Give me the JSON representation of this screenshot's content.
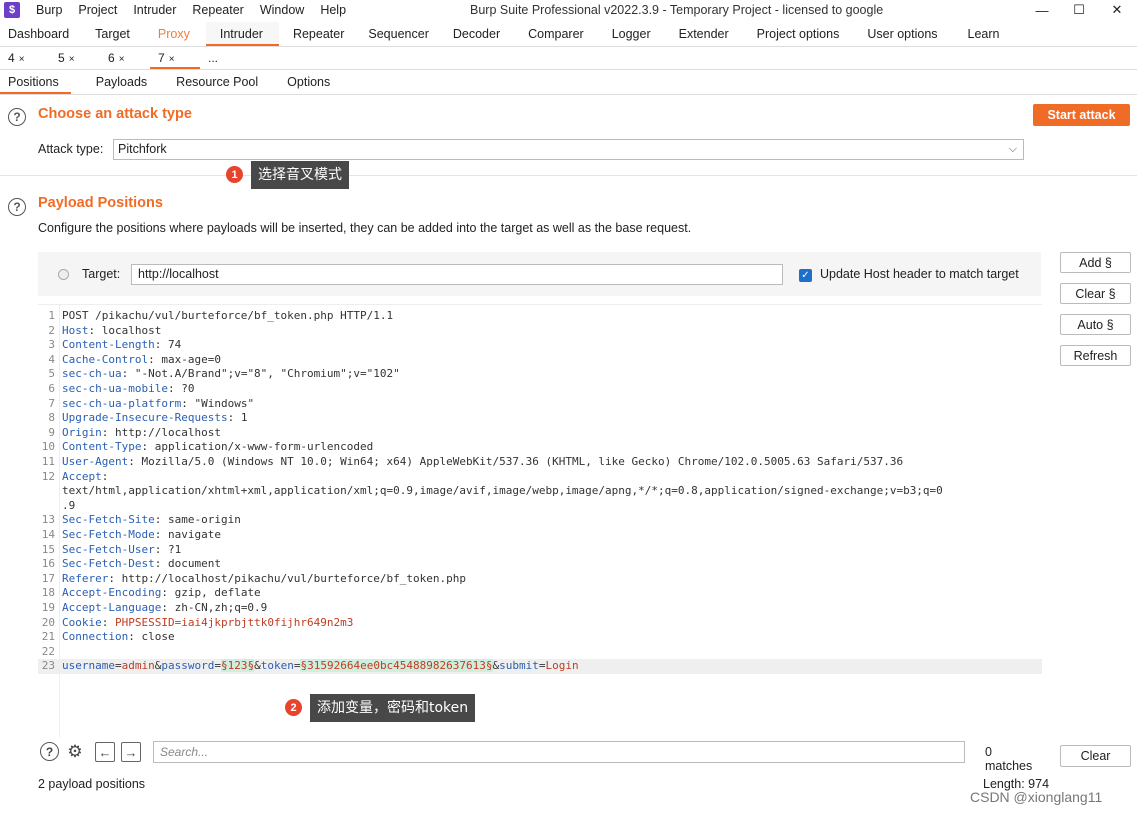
{
  "app": {
    "icon_label": "$",
    "title": "Burp Suite Professional v2022.3.9 - Temporary Project - licensed to google"
  },
  "menu": [
    "Burp",
    "Project",
    "Intruder",
    "Repeater",
    "Window",
    "Help"
  ],
  "window_controls": {
    "minimize": "—",
    "maximize": "☐",
    "close": "✕"
  },
  "main_tabs": [
    "Dashboard",
    "Target",
    "Proxy",
    "Intruder",
    "Repeater",
    "Sequencer",
    "Decoder",
    "Comparer",
    "Logger",
    "Extender",
    "Project options",
    "User options",
    "Learn"
  ],
  "sub_tabs": [
    {
      "label": "4",
      "close": "×"
    },
    {
      "label": "5",
      "close": "×"
    },
    {
      "label": "6",
      "close": "×"
    },
    {
      "label": "7",
      "close": "×"
    },
    {
      "label": "...",
      "close": ""
    }
  ],
  "section_tabs": [
    "Positions",
    "Payloads",
    "Resource Pool",
    "Options"
  ],
  "attack": {
    "title": "Choose an attack type",
    "start_label": "Start attack",
    "type_label": "Attack type:",
    "type_value": "Pitchfork",
    "chevron": "⌵"
  },
  "positions": {
    "title": "Payload Positions",
    "description": "Configure the positions where payloads will be inserted, they can be added into the target as well as the base request.",
    "target_label": "Target:",
    "target_value": "http://localhost",
    "update_host_label": "Update Host header to match target",
    "update_host_checked": true,
    "buttons": {
      "add": "Add §",
      "clear": "Clear §",
      "auto": "Auto §",
      "refresh": "Refresh"
    }
  },
  "request_lines": [
    {
      "n": "1",
      "text": "POST /pikachu/vul/burteforce/bf_token.php HTTP/1.1"
    },
    {
      "n": "2",
      "key": "Host",
      "text": ": localhost"
    },
    {
      "n": "3",
      "key": "Content-Length",
      "text": ": 74"
    },
    {
      "n": "4",
      "key": "Cache-Control",
      "text": ": max-age=0"
    },
    {
      "n": "5",
      "key": "sec-ch-ua",
      "text": ": \"-Not.A/Brand\";v=\"8\", \"Chromium\";v=\"102\""
    },
    {
      "n": "6",
      "key": "sec-ch-ua-mobile",
      "text": ": ?0"
    },
    {
      "n": "7",
      "key": "sec-ch-ua-platform",
      "text": ": \"Windows\""
    },
    {
      "n": "8",
      "key": "Upgrade-Insecure-Requests",
      "text": ": 1"
    },
    {
      "n": "9",
      "key": "Origin",
      "text": ": http://localhost"
    },
    {
      "n": "10",
      "key": "Content-Type",
      "text": ": application/x-www-form-urlencoded"
    },
    {
      "n": "11",
      "key": "User-Agent",
      "text": ": Mozilla/5.0 (Windows NT 10.0; Win64; x64) AppleWebKit/537.36 (KHTML, like Gecko) Chrome/102.0.5005.63 Safari/537.36"
    },
    {
      "n": "12",
      "key": "Accept",
      "text": ":"
    },
    {
      "n": "",
      "text": "text/html,application/xhtml+xml,application/xml;q=0.9,image/avif,image/webp,image/apng,*/*;q=0.8,application/signed-exchange;v=b3;q=0"
    },
    {
      "n": "",
      "text": ".9"
    },
    {
      "n": "13",
      "key": "Sec-Fetch-Site",
      "text": ": same-origin"
    },
    {
      "n": "14",
      "key": "Sec-Fetch-Mode",
      "text": ": navigate"
    },
    {
      "n": "15",
      "key": "Sec-Fetch-User",
      "text": ": ?1"
    },
    {
      "n": "16",
      "key": "Sec-Fetch-Dest",
      "text": ": document"
    },
    {
      "n": "17",
      "key": "Referer",
      "text": ": http://localhost/pikachu/vul/burteforce/bf_token.php"
    },
    {
      "n": "18",
      "key": "Accept-Encoding",
      "text": ": gzip, deflate"
    },
    {
      "n": "19",
      "key": "Accept-Language",
      "text": ": zh-CN,zh;q=0.9"
    },
    {
      "n": "20",
      "key": "Cookie",
      "text": ": ",
      "val": "PHPSESSID=iai4jkprbjttk0fijhr649n2m3"
    },
    {
      "n": "21",
      "key": "Connection",
      "text": ": close"
    },
    {
      "n": "22",
      "text": ""
    },
    {
      "n": "23",
      "body": [
        {
          "t": "k",
          "s": "username"
        },
        {
          "t": "p",
          "s": "="
        },
        {
          "t": "v",
          "s": "admin"
        },
        {
          "t": "p",
          "s": "&"
        },
        {
          "t": "k",
          "s": "password"
        },
        {
          "t": "p",
          "s": "="
        },
        {
          "t": "m",
          "s": "§123§"
        },
        {
          "t": "p",
          "s": "&"
        },
        {
          "t": "k",
          "s": "token"
        },
        {
          "t": "p",
          "s": "="
        },
        {
          "t": "m",
          "s": "§31592664ee0bc454889826376 13§"
        },
        {
          "t": "p",
          "s": "&"
        },
        {
          "t": "k",
          "s": "submit"
        },
        {
          "t": "p",
          "s": "="
        },
        {
          "t": "v",
          "s": "Login"
        }
      ]
    }
  ],
  "annotations": [
    {
      "num": "1",
      "text": "选择音叉模式"
    },
    {
      "num": "2",
      "text": "添加变量，密码和token"
    }
  ],
  "search": {
    "placeholder": "Search...",
    "matches": "0 matches",
    "clear_label": "Clear"
  },
  "footer": {
    "payload_positions": "2 payload positions",
    "length": "Length: 974"
  },
  "watermark": "CSDN @xionglang11",
  "colors": {
    "accent": "#f06b25",
    "key": "#2a5fb4",
    "value": "#c23b22",
    "payload_marker_bg": "#cfeedd",
    "callout_bg": "#484848"
  }
}
